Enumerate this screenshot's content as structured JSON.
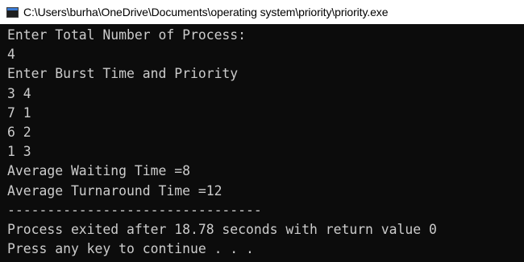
{
  "window": {
    "title": "C:\\Users\\burha\\OneDrive\\Documents\\operating system\\priority\\priority.exe",
    "icon": "console-app-icon"
  },
  "console": {
    "colors": {
      "background": "#0c0c0c",
      "text": "#cccccc"
    },
    "lines": [
      "Enter Total Number of Process:",
      "4",
      "Enter Burst Time and Priority",
      "3 4",
      "7 1",
      "6 2",
      "1 3",
      "Average Waiting Time =8",
      "Average Turnaround Time =12",
      "--------------------------------",
      "Process exited after 18.78 seconds with return value 0",
      "Press any key to continue . . ."
    ]
  }
}
